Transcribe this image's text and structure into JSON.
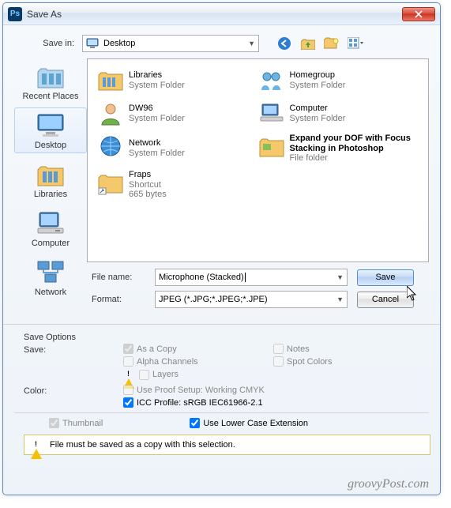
{
  "window": {
    "title": "Save As"
  },
  "savein": {
    "label": "Save in:",
    "value": "Desktop"
  },
  "places": [
    {
      "label": "Recent Places"
    },
    {
      "label": "Desktop"
    },
    {
      "label": "Libraries"
    },
    {
      "label": "Computer"
    },
    {
      "label": "Network"
    }
  ],
  "files": [
    {
      "name": "Libraries",
      "type": "System Folder"
    },
    {
      "name": "Homegroup",
      "type": "System Folder"
    },
    {
      "name": "DW96",
      "type": "System Folder"
    },
    {
      "name": "Computer",
      "type": "System Folder"
    },
    {
      "name": "Network",
      "type": "System Folder"
    },
    {
      "name": "Expand your DOF with Focus Stacking in Photoshop",
      "type": "File folder"
    },
    {
      "name": "Fraps",
      "type": "Shortcut",
      "extra": "665 bytes"
    }
  ],
  "form": {
    "filename_label": "File name:",
    "filename_value": "Microphone (Stacked)",
    "format_label": "Format:",
    "format_value": "JPEG (*.JPG;*.JPEG;*.JPE)",
    "save": "Save",
    "cancel": "Cancel"
  },
  "options": {
    "heading": "Save Options",
    "save_label": "Save:",
    "as_copy": "As a Copy",
    "notes": "Notes",
    "alpha": "Alpha Channels",
    "spot": "Spot Colors",
    "layers": "Layers",
    "color_label": "Color:",
    "proof": "Use Proof Setup:  Working CMYK",
    "icc": "ICC Profile:  sRGB IEC61966-2.1",
    "thumbnail": "Thumbnail",
    "lowercase": "Use Lower Case Extension"
  },
  "info": "File must be saved as a copy with this selection.",
  "watermark": "groovyPost.com"
}
